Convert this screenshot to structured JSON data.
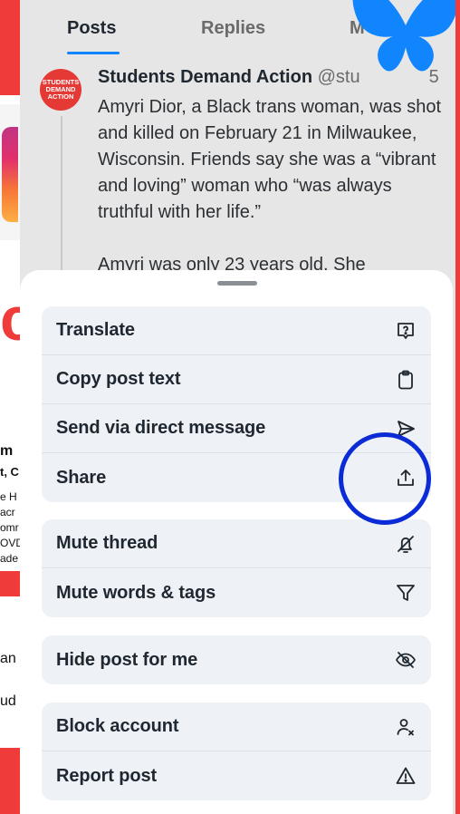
{
  "tabs": [
    {
      "label": "Posts",
      "active": true
    },
    {
      "label": "Replies",
      "active": false
    },
    {
      "label": "M",
      "active": false
    }
  ],
  "post": {
    "avatar_text": "STUDENTS DEMAND ACTION",
    "author": "Students Demand Action",
    "handle": "@stu",
    "handle_tail": "5",
    "paragraph1": "Amyri Dior, a Black trans woman, was shot and killed on February 21 in Milwaukee, Wisconsin. Friends say she was a “vibrant and loving” woman who “was always truthful with her life.”",
    "paragraph2": "Amyri was only 23 years old. She"
  },
  "menu": {
    "groups": [
      {
        "items": [
          {
            "label": "Translate",
            "icon": "translate-icon"
          },
          {
            "label": "Copy post text",
            "icon": "clipboard-icon"
          },
          {
            "label": "Send via direct message",
            "icon": "paper-plane-icon"
          },
          {
            "label": "Share",
            "icon": "share-icon"
          }
        ]
      },
      {
        "items": [
          {
            "label": "Mute thread",
            "icon": "bell-off-icon"
          },
          {
            "label": "Mute words & tags",
            "icon": "filter-icon"
          }
        ]
      },
      {
        "items": [
          {
            "label": "Hide post for me",
            "icon": "eye-off-icon"
          }
        ]
      },
      {
        "items": [
          {
            "label": "Block account",
            "icon": "user-block-icon"
          },
          {
            "label": "Report post",
            "icon": "warning-icon"
          }
        ]
      }
    ]
  },
  "background_fragments": {
    "m": "m",
    "t": "t, C",
    "line1": "e H",
    "line2": "acr",
    "line3": "omr",
    "line4": "OVD",
    "line5": "ade",
    "an": "an",
    "ud": "ud"
  },
  "colors": {
    "accent": "#1083fe",
    "annotation_circle": "#0a2bd6",
    "butterfly": "#1185fe",
    "brand_red": "#ef3b3a"
  }
}
